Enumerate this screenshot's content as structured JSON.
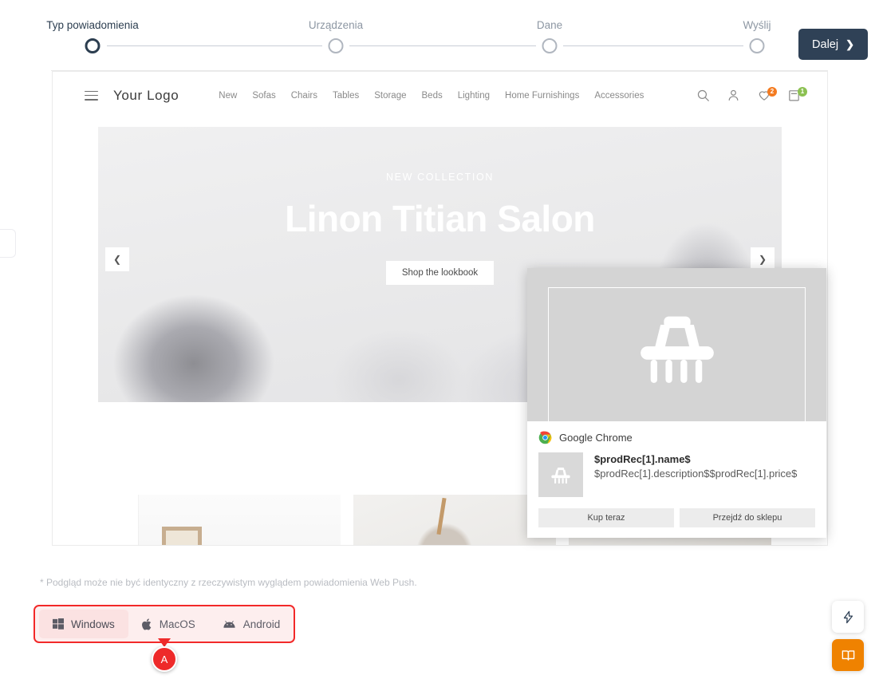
{
  "wizard": {
    "steps": [
      {
        "label": "Typ powiadomienia",
        "active": true
      },
      {
        "label": "Urządzenia",
        "active": false
      },
      {
        "label": "Dane",
        "active": false
      },
      {
        "label": "Wyślij",
        "active": false
      }
    ],
    "next_label": "Dalej",
    "next_chevron": "chevron-right-icon"
  },
  "preview": {
    "site": {
      "logo": "Your Logo",
      "menu_icon": "hamburger-icon",
      "nav": [
        "New",
        "Sofas",
        "Chairs",
        "Tables",
        "Storage",
        "Beds",
        "Lighting",
        "Home Furnishings",
        "Accessories"
      ],
      "icons": {
        "search": "search-icon",
        "account": "user-icon",
        "wishlist": "heart-icon",
        "cart": "bag-icon"
      },
      "wishlist_count": "2",
      "cart_count": "1",
      "wishlist_badge_color": "#f47b20",
      "cart_badge_color": "#8cc152"
    },
    "hero": {
      "kicker": "NEW COLLECTION",
      "title": "Linon Titian Salon",
      "cta": "Shop the lookbook",
      "prev_icon": "chevron-left-icon",
      "next_icon": "chevron-right-icon"
    },
    "tiles_next_icon": "chevron-right-icon"
  },
  "notification": {
    "source": "Google Chrome",
    "source_icon": "chrome-icon",
    "image_icon": "shopping-basket-icon",
    "thumb_icon": "shopping-basket-icon",
    "title": "$prodRec[1].name$",
    "description": "$prodRec[1].description$$prodRec[1].price$",
    "buttons": [
      "Kup teraz",
      "Przejdź do sklepu"
    ]
  },
  "footer": {
    "note": "* Podgląd może nie być identyczny z rzeczywistym wyglądem powiadomienia Web Push.",
    "os_tabs": [
      {
        "label": "Windows",
        "icon": "windows-icon",
        "active": true
      },
      {
        "label": "MacOS",
        "icon": "apple-icon",
        "active": false
      },
      {
        "label": "Android",
        "icon": "android-icon",
        "active": false
      }
    ],
    "highlight_color": "#f22929",
    "marker_letter": "A"
  },
  "fabs": [
    {
      "name": "lightning-icon",
      "color": "#ffffff"
    },
    {
      "name": "book-icon",
      "color": "#ef8200"
    }
  ]
}
